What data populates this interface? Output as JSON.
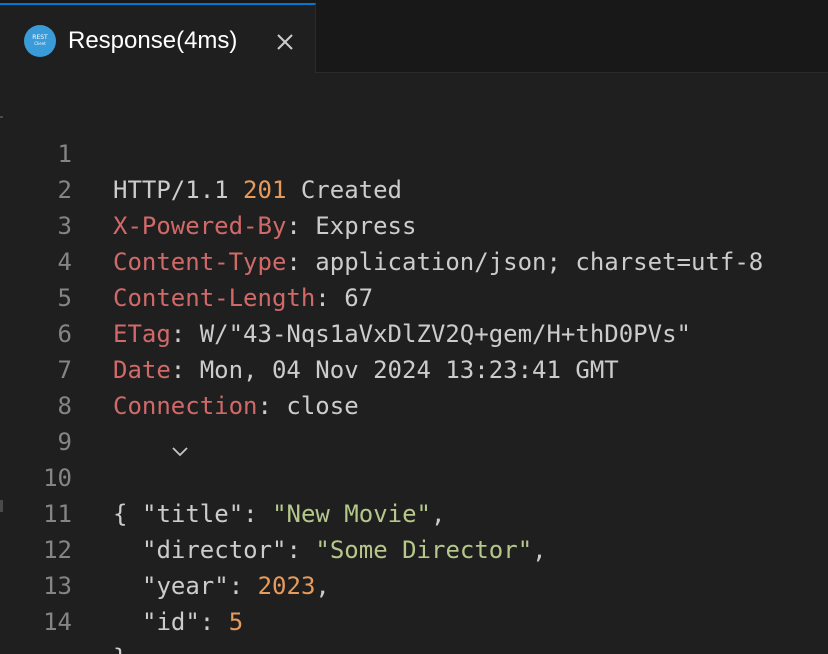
{
  "tab": {
    "title": "Response(4ms)",
    "icon_label_top": "REST",
    "icon_label_bottom": "Client"
  },
  "colors": {
    "header_key": "#d16969",
    "number": "#e69a5c",
    "json_string": "#b5c78a",
    "plain": "#cccccc",
    "line_number": "#858585",
    "tab_accent": "#0078d4"
  },
  "lines": [
    {
      "n": "1",
      "parts": {
        "a": "HTTP/1.1 ",
        "b": "201",
        "c": " Created"
      }
    },
    {
      "n": "2",
      "key": "X-Powered-By",
      "sep": ": ",
      "value": "Express"
    },
    {
      "n": "3",
      "key": "Content-Type",
      "sep": ": ",
      "value": "application/json; charset=utf-8"
    },
    {
      "n": "4",
      "key": "Content-Length",
      "sep": ": ",
      "value": "67"
    },
    {
      "n": "5",
      "key": "ETag",
      "sep": ": ",
      "value": "W/\"43-Nqs1aVxDlZV2Q+gem/H+thD0PVs\""
    },
    {
      "n": "6",
      "key": "Date",
      "sep": ": ",
      "value": "Mon, 04 Nov 2024 13:23:41 GMT"
    },
    {
      "n": "7",
      "key": "Connection",
      "sep": ": ",
      "value": "close"
    },
    {
      "n": "8"
    },
    {
      "n": "9",
      "text": "{"
    },
    {
      "n": "10",
      "jkey": "\"title\"",
      "sep": ": ",
      "jval": "\"New Movie\"",
      "end": ","
    },
    {
      "n": "11",
      "jkey": "\"director\"",
      "sep": ": ",
      "jval": "\"Some Director\"",
      "end": ","
    },
    {
      "n": "12",
      "jkey": "\"year\"",
      "sep": ": ",
      "jnum": "2023",
      "end": ","
    },
    {
      "n": "13",
      "jkey": "\"id\"",
      "sep": ": ",
      "jnum": "5"
    },
    {
      "n": "14",
      "text": "}"
    }
  ]
}
